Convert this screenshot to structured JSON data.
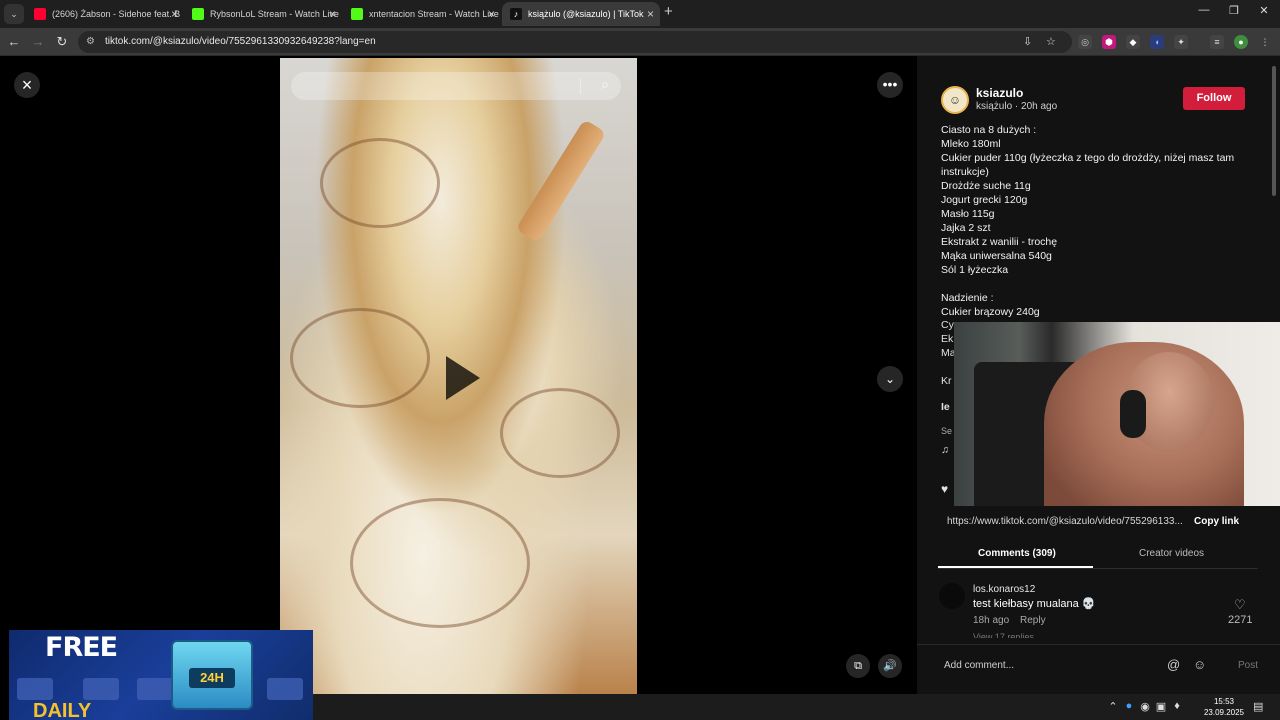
{
  "browser": {
    "tabs": [
      {
        "title": "(2606) Żabson - Sidehoe feat. B",
        "favicon_color": "#ff0033",
        "active": false
      },
      {
        "title": "RybsonLoL Stream - Watch Live",
        "favicon_color": "#53fc18",
        "active": false
      },
      {
        "title": "xntentacion Stream - Watch Live",
        "favicon_color": "#53fc18",
        "active": false
      },
      {
        "title": "książulo (@ksiazulo) | TikTok",
        "favicon_color": "#ffffff",
        "active": true
      }
    ],
    "url": "tiktok.com/@ksiazulo/video/7552961330932649238?lang=en"
  },
  "video": {
    "search_placeholder": "",
    "icons": {
      "close": "×",
      "more": "•••",
      "down": "⌄",
      "pip": "⧉",
      "volume": "🔊",
      "search": "⌕"
    }
  },
  "panel": {
    "author": {
      "display_name": "ksiazulo",
      "meta": "książulo · 20h ago",
      "follow_label": "Follow"
    },
    "description_lines": [
      "Ciasto na 8 dużych :",
      "Mleko 180ml",
      "Cukier puder 110g (łyżeczka z tego do drożdży, niżej masz tam instrukcje)",
      "Drożdże suche 11g",
      "Jogurt grecki 120g",
      "Masło 115g",
      "Jajka 2 szt",
      "Ekstrakt z wanilii - trochę",
      "Mąka uniwersalna 540g",
      "Sól 1 łyżeczka",
      "",
      "Nadzienie :",
      "Cukier brązowy 240g"
    ],
    "description_trail": [
      "Cy",
      "Ek",
      "Ma",
      "Kr",
      "Ie",
      "Se",
      "♫"
    ],
    "share_link": "https://www.tiktok.com/@ksiazulo/video/755296133...",
    "copy_link_label": "Copy link",
    "tabs": {
      "comments": "Comments (309)",
      "creator_videos": "Creator videos"
    },
    "comment": {
      "user": "los.konaros12",
      "text": "test kiełbasy mualana 💀",
      "time": "18h ago",
      "reply_label": "Reply",
      "likes": "2271",
      "more_replies": "View 17 replies"
    },
    "input": {
      "placeholder": "Add comment...",
      "post_label": "Post"
    }
  },
  "overlay": {
    "promo_free": "FREE",
    "promo_badge": "24H",
    "promo_daily": "DAILY"
  },
  "taskbar": {
    "time": "15:53",
    "date": "23.09.2025"
  }
}
